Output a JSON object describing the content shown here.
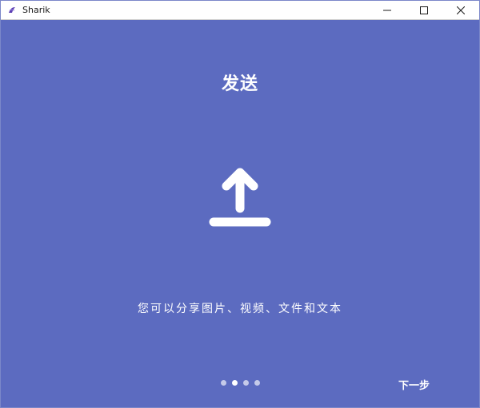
{
  "window": {
    "title": "Sharik",
    "controls": [
      "minimize-icon",
      "maximize-icon",
      "close-icon"
    ]
  },
  "main": {
    "heading": "发送",
    "icon": "upload-icon",
    "description": "您可以分享图片、视频、文件和文本"
  },
  "pagination": {
    "total": 4,
    "active_index": 1
  },
  "footer": {
    "next_label": "下一步"
  },
  "colors": {
    "background": "#5c6bc0",
    "foreground": "#ffffff",
    "dot_inactive": "#c5cae9",
    "app_icon": "#5c3fb3"
  }
}
